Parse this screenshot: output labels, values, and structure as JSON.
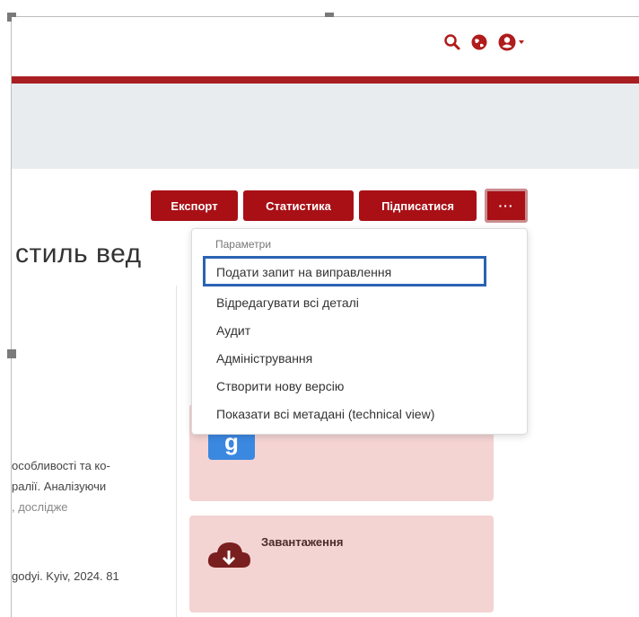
{
  "header": {
    "icons": [
      "search-icon",
      "globe-icon",
      "user-icon"
    ],
    "accent_color": "#a91e22"
  },
  "actions": {
    "export_label": "Експорт",
    "stats_label": "Статистика",
    "subscribe_label": "Підписатися",
    "more_label": "···"
  },
  "page_title": "стиль вед",
  "dropdown": {
    "header": "Параметри",
    "items": [
      "Подати запит на виправлення",
      "Відредагувати всі деталі",
      "Аудит",
      "Адміністрування",
      "Створити нову версію",
      "Показати всі метадані (technical view)"
    ]
  },
  "abstract_fragments": [
    "особливості та ко-",
    "ралії. Аналізуючи",
    ", дослідже"
  ],
  "citation_fragment": "godyi. Kyiv, 2024. 81",
  "cards": {
    "google_icon_glyph": "g",
    "download_label": "Завантаження"
  }
}
